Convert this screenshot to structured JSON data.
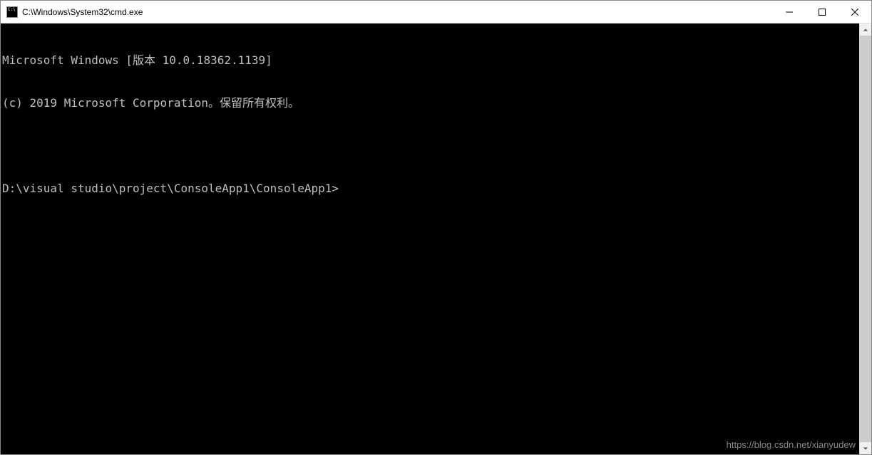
{
  "window": {
    "title": "C:\\Windows\\System32\\cmd.exe"
  },
  "terminal": {
    "line1": "Microsoft Windows [版本 10.0.18362.1139]",
    "line2": "(c) 2019 Microsoft Corporation。保留所有权利。",
    "line3": "",
    "prompt": "D:\\visual studio\\project\\ConsoleApp1\\ConsoleApp1>"
  },
  "watermark": "https://blog.csdn.net/xianyudew"
}
